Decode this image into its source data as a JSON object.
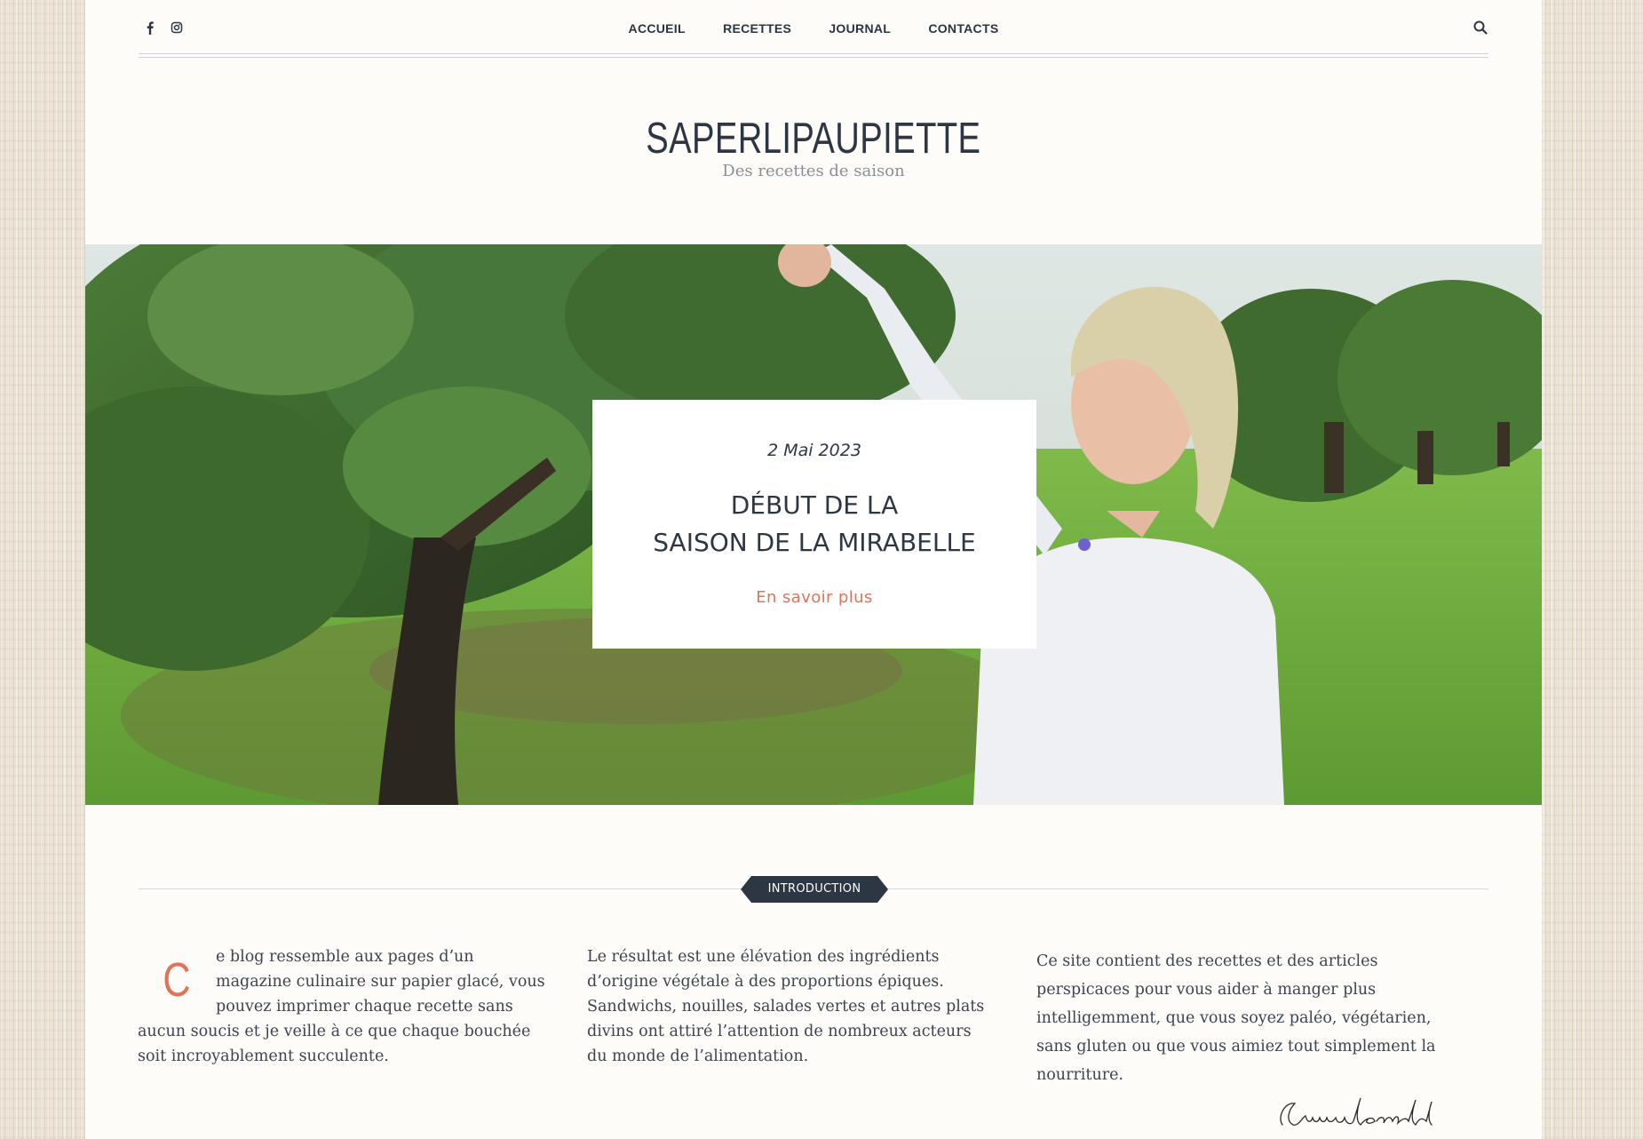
{
  "nav": {
    "items": [
      "ACCUEIL",
      "RECETTES",
      "JOURNAL",
      "CONTACTS"
    ]
  },
  "icons": {
    "facebook": "facebook-icon",
    "instagram": "instagram-icon",
    "search": "search-icon"
  },
  "site": {
    "title": "SAPERLIPAUPIETTE",
    "tagline": "Des recettes de saison"
  },
  "hero": {
    "date": "2 Mai 2023",
    "title_line1": "DÉBUT DE LA",
    "title_line2": "SAISON DE LA MIRABELLE",
    "cta": "En savoir plus"
  },
  "intro": {
    "badge": "INTRODUCTION",
    "dropcap": "C",
    "col1": "e blog ressemble aux pages d’un magazine culinaire sur papier glacé, vous pouvez imprimer chaque recette sans aucun soucis et je veille à ce que chaque bouchée soit incroyablement succulente.",
    "col2": "Le résultat est une élévation des ingrédients d’origine végétale à des proportions épiques. Sandwichs, nouilles, salades vertes et autres plats divins ont attiré l’attention de nombreux acteurs du monde de l’alimentation.",
    "col3": "Ce site contient des recettes et des articles perspicaces pour vous aider à manger plus intelligemment, que vous soyez paléo, végétarien, sans gluten ou que vous aimiez tout simplement la nourriture.",
    "signature": "Emmanuelle Bertorelli"
  },
  "colors": {
    "accent": "#e0735a",
    "navy": "#2d3643",
    "page": "#fdfcf8"
  }
}
